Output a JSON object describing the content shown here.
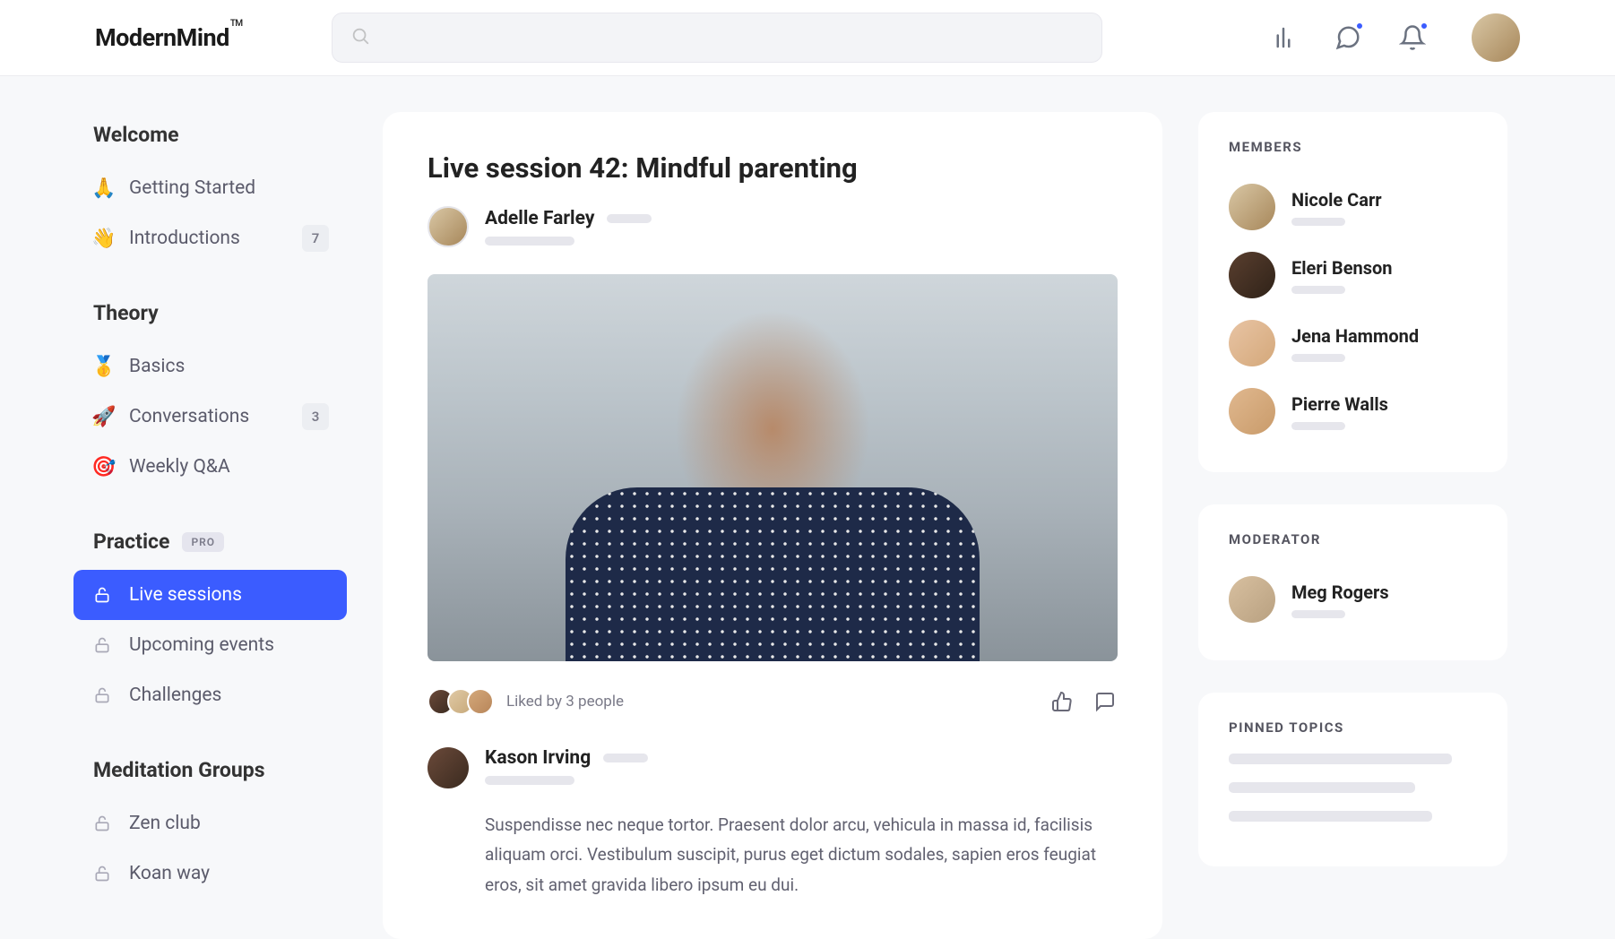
{
  "brand": {
    "name": "ModernMind",
    "tm": "TM"
  },
  "search": {
    "placeholder": ""
  },
  "sidebar": {
    "sections": [
      {
        "title": "Welcome",
        "items": [
          {
            "emoji": "🙏",
            "label": "Getting Started",
            "count": null
          },
          {
            "emoji": "👋",
            "label": "Introductions",
            "count": "7"
          }
        ]
      },
      {
        "title": "Theory",
        "items": [
          {
            "emoji": "🥇",
            "label": "Basics",
            "count": null
          },
          {
            "emoji": "🚀",
            "label": "Conversations",
            "count": "3"
          },
          {
            "emoji": "🎯",
            "label": "Weekly Q&A",
            "count": null
          }
        ]
      },
      {
        "title": "Practice",
        "badge": "PRO",
        "items": [
          {
            "lock": true,
            "label": "Live sessions",
            "active": true
          },
          {
            "lock": true,
            "label": "Upcoming events"
          },
          {
            "lock": true,
            "label": "Challenges"
          }
        ]
      },
      {
        "title": "Meditation Groups",
        "items": [
          {
            "lock": true,
            "label": "Zen club"
          },
          {
            "lock": true,
            "label": "Koan way"
          }
        ]
      }
    ]
  },
  "post": {
    "title": "Live session 42: Mindful parenting",
    "author": "Adelle Farley",
    "liked_by": "Liked by 3 people",
    "comment_author": "Kason Irving",
    "comment_text": "Suspendisse nec neque tortor. Praesent dolor arcu, vehicula in massa id, facilisis aliquam orci. Vestibulum suscipit, purus eget dictum sodales, sapien eros feugiat eros, sit amet gravida libero ipsum eu dui."
  },
  "members": {
    "title": "Members",
    "list": [
      {
        "name": "Nicole Carr"
      },
      {
        "name": "Eleri Benson"
      },
      {
        "name": "Jena Hammond"
      },
      {
        "name": "Pierre Walls"
      }
    ]
  },
  "moderator": {
    "title": "Moderator",
    "list": [
      {
        "name": "Meg Rogers"
      }
    ]
  },
  "pinned": {
    "title": "Pinned Topics"
  }
}
